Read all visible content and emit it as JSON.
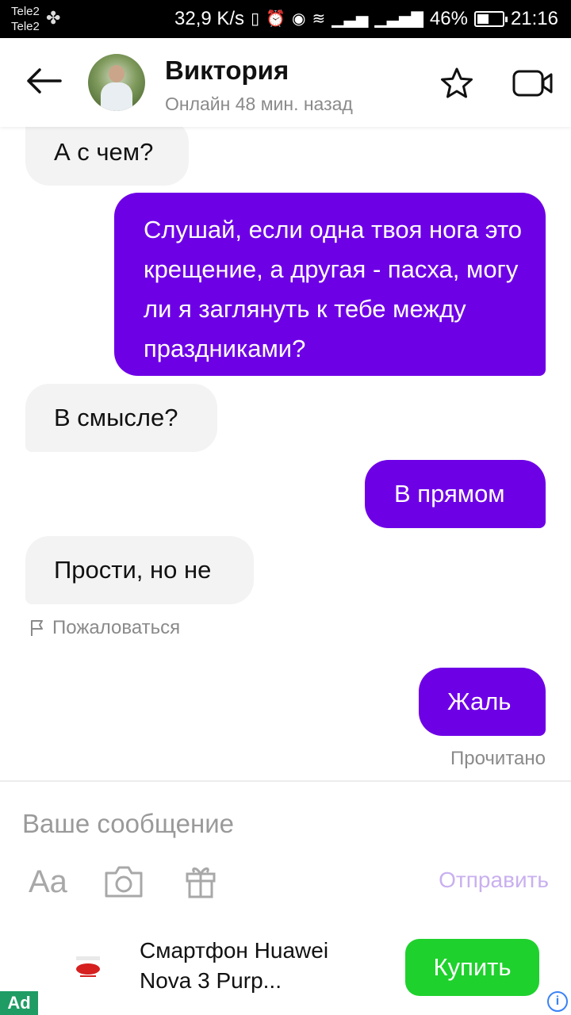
{
  "status_bar": {
    "carrier1": "Tele2",
    "carrier2": "Tele2",
    "speed": "32,9 K/s",
    "battery": "46%",
    "battery_level": 0.46,
    "time": "21:16"
  },
  "header": {
    "name": "Виктория",
    "status": "Онлайн 48 мин. назад"
  },
  "messages": [
    {
      "direction": "incoming",
      "text": "А с чем?"
    },
    {
      "direction": "outgoing",
      "text": "Слушай, если одна твоя нога это крещение, а другая - пасха, могу ли я заглянуть к тебе между праздниками?"
    },
    {
      "direction": "incoming",
      "text": "В смысле?"
    },
    {
      "direction": "outgoing",
      "text": "В прямом"
    },
    {
      "direction": "incoming",
      "text": "Прости, но не"
    },
    {
      "direction": "outgoing",
      "text": "Жаль"
    }
  ],
  "report_label": "Пожаловаться",
  "read_label": "Прочитано",
  "composer": {
    "placeholder": "Ваше сообщение",
    "format_label": "Aa",
    "send_label": "Отправить"
  },
  "ad": {
    "title": "Смартфон Huawei Nova 3 Purp...",
    "buy_label": "Купить",
    "badge": "Ad",
    "info_symbol": "i"
  },
  "colors": {
    "outgoing_bubble": "#6e00e6",
    "incoming_bubble": "#f3f3f3",
    "buy_button": "#1fd12d",
    "send_text": "#c9b0ef"
  }
}
